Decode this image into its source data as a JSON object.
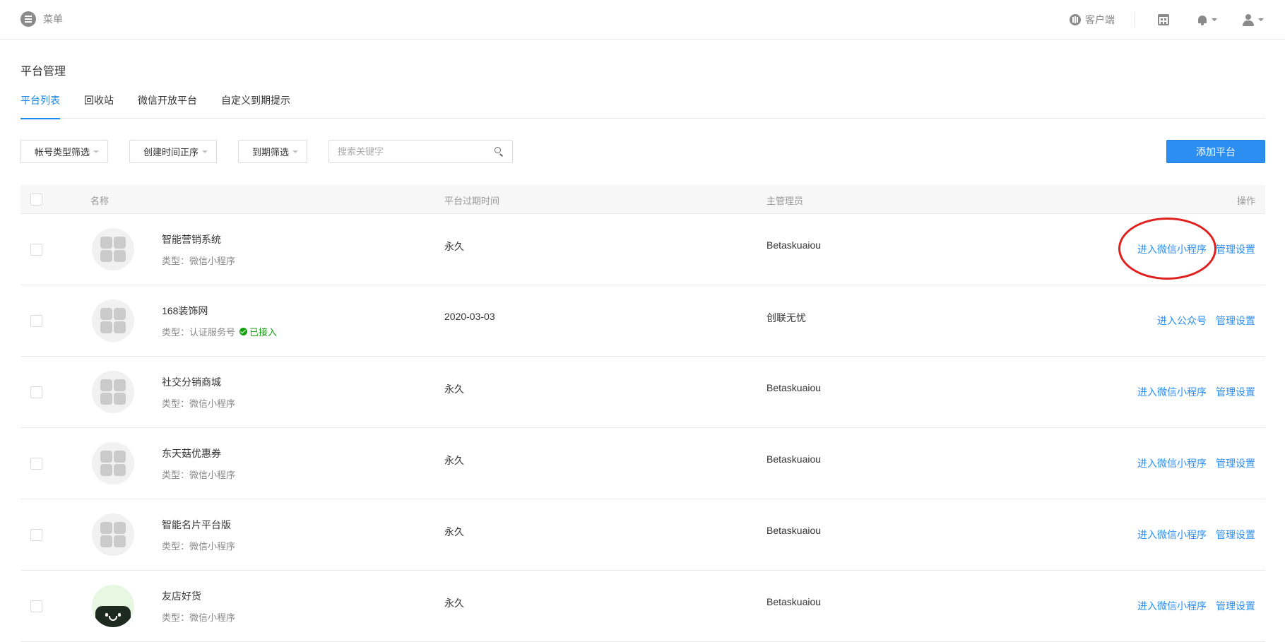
{
  "topbar": {
    "menu_label": "菜单",
    "client_label": "客户端",
    "icons": [
      "menu-icon",
      "client-icon",
      "calendar-icon",
      "bell-icon",
      "user-icon"
    ]
  },
  "page_title": "平台管理",
  "tabs": [
    {
      "label": "平台列表",
      "active": true
    },
    {
      "label": "回收站",
      "active": false
    },
    {
      "label": "微信开放平台",
      "active": false
    },
    {
      "label": "自定义到期提示",
      "active": false
    }
  ],
  "filters": {
    "account_type": "帐号类型筛选",
    "created_order": "创建时间正序",
    "expiry": "到期筛选",
    "search_placeholder": "搜索关键字",
    "search_value": ""
  },
  "add_button": "添加平台",
  "table": {
    "headers": {
      "name": "名称",
      "expire": "平台过期时间",
      "admin": "主管理员",
      "actions": "操作"
    },
    "rows": [
      {
        "name": "智能营销系统",
        "type": "类型：微信小程序",
        "badge": "",
        "expire": "永久",
        "admin": "Betaskuaiou",
        "enter": "进入微信小程序",
        "manage": "管理设置",
        "avatar": "grid"
      },
      {
        "name": "168装饰网",
        "type": "类型：认证服务号",
        "badge": "已接入",
        "expire": "2020-03-03",
        "admin": "创联无忧",
        "enter": "进入公众号",
        "manage": "管理设置",
        "avatar": "grid"
      },
      {
        "name": "社交分销商城",
        "type": "类型：微信小程序",
        "badge": "",
        "expire": "永久",
        "admin": "Betaskuaiou",
        "enter": "进入微信小程序",
        "manage": "管理设置",
        "avatar": "grid"
      },
      {
        "name": "东天菇优惠券",
        "type": "类型：微信小程序",
        "badge": "",
        "expire": "永久",
        "admin": "Betaskuaiou",
        "enter": "进入微信小程序",
        "manage": "管理设置",
        "avatar": "grid"
      },
      {
        "name": "智能名片平台版",
        "type": "类型：微信小程序",
        "badge": "",
        "expire": "永久",
        "admin": "Betaskuaiou",
        "enter": "进入微信小程序",
        "manage": "管理设置",
        "avatar": "grid"
      },
      {
        "name": "友店好货",
        "type": "类型：微信小程序",
        "badge": "",
        "expire": "永久",
        "admin": "Betaskuaiou",
        "enter": "进入微信小程序",
        "manage": "管理设置",
        "avatar": "shop"
      }
    ]
  },
  "colors": {
    "accent": "#2b8ef0",
    "tab_active": "#1c88e8",
    "success": "#13a10e",
    "annotation": "#e0201f"
  }
}
